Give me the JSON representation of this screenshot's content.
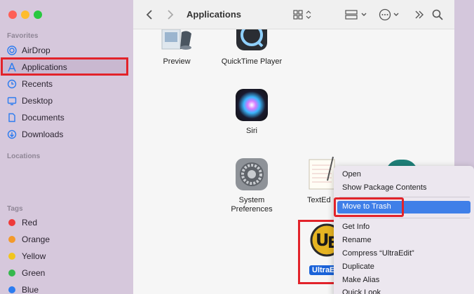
{
  "window": {
    "title": "Applications"
  },
  "sidebar": {
    "favorites_heading": "Favorites",
    "favorites": [
      {
        "label": "AirDrop",
        "icon": "airdrop-icon"
      },
      {
        "label": "Applications",
        "icon": "applications-icon",
        "selected": true
      },
      {
        "label": "Recents",
        "icon": "clock-icon"
      },
      {
        "label": "Desktop",
        "icon": "desktop-icon"
      },
      {
        "label": "Documents",
        "icon": "document-icon"
      },
      {
        "label": "Downloads",
        "icon": "download-icon"
      }
    ],
    "locations_heading": "Locations",
    "tags_heading": "Tags",
    "tags": [
      {
        "label": "Red",
        "color": "#ee3a3a"
      },
      {
        "label": "Orange",
        "color": "#f39a2b"
      },
      {
        "label": "Yellow",
        "color": "#f1c51d"
      },
      {
        "label": "Green",
        "color": "#35b84d"
      },
      {
        "label": "Blue",
        "color": "#2c7cf0"
      }
    ]
  },
  "apps": [
    {
      "label": "Preview"
    },
    {
      "label": "QuickTime Player"
    },
    {
      "label": "Siri"
    },
    {
      "label": "System Preferences"
    },
    {
      "label": "TextEd"
    },
    {
      "label": "UltraEd"
    }
  ],
  "context_menu": {
    "items": [
      "Open",
      "Show Package Contents",
      "Move to Trash",
      "Get Info",
      "Rename",
      "Compress “UltraEdit”",
      "Duplicate",
      "Make Alias",
      "Quick Look"
    ],
    "highlighted": "Move to Trash"
  },
  "accent": "#3f7fe8",
  "annotation_color": "#e2232a"
}
